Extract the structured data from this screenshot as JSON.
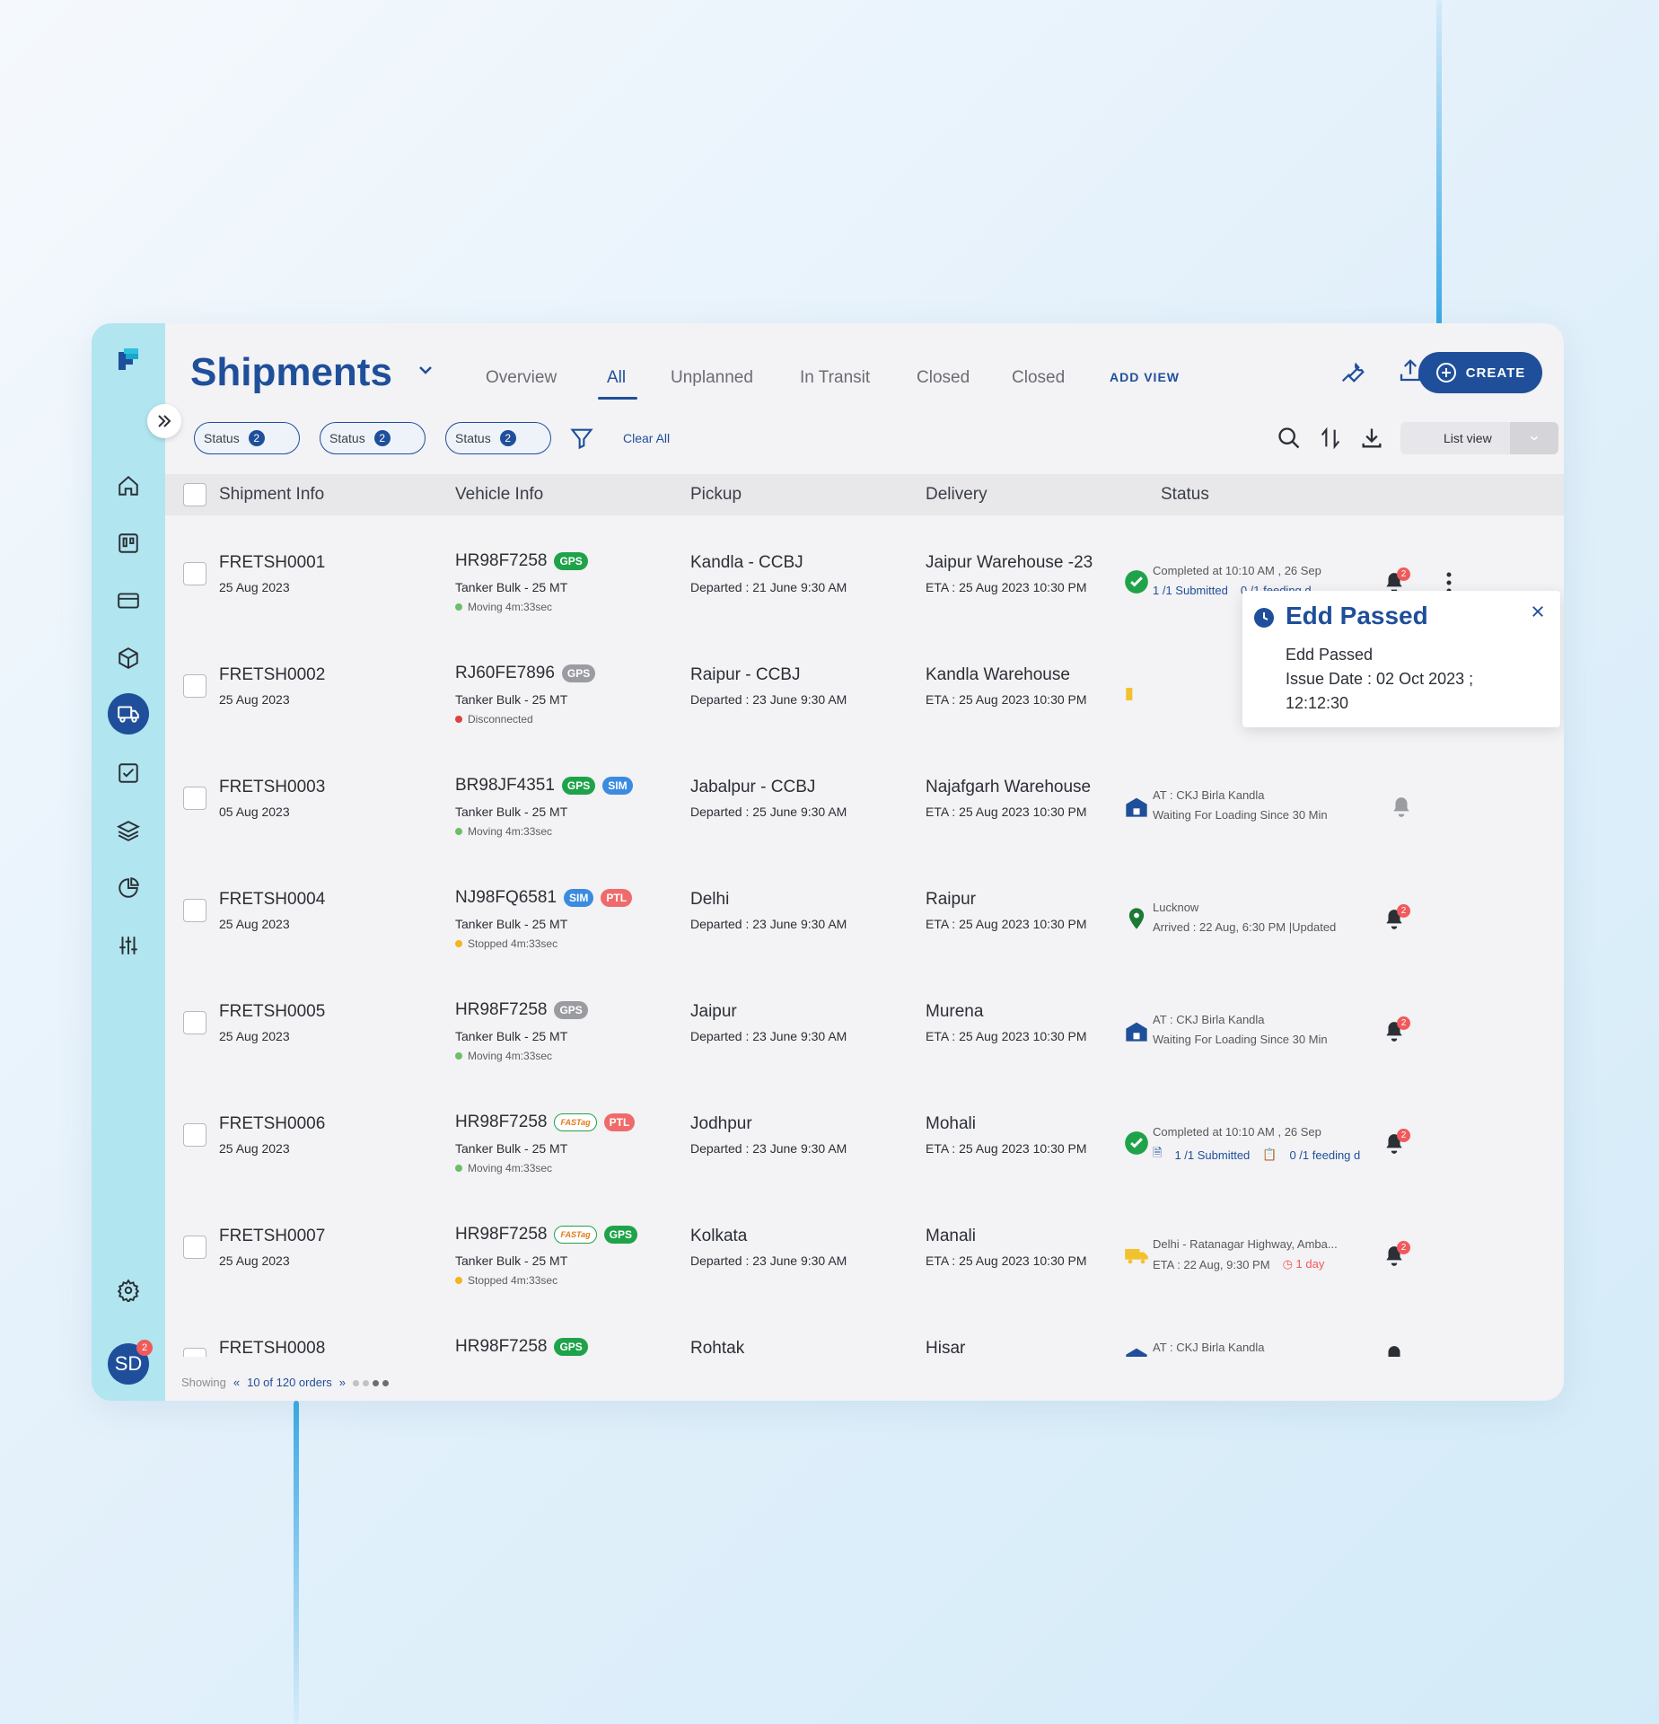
{
  "header": {
    "title": "Shipments",
    "tabs": [
      "Overview",
      "All",
      "Unplanned",
      "In Transit",
      "Closed",
      "Closed"
    ],
    "active_tab": "All",
    "add_view": "ADD VIEW",
    "create_label": "CREATE"
  },
  "filters": {
    "chips": [
      {
        "label": "Status",
        "count": "2"
      },
      {
        "label": "Status",
        "count": "2"
      },
      {
        "label": "Status",
        "count": "2"
      }
    ],
    "clear_all": "Clear All",
    "view_select": "List view"
  },
  "table": {
    "columns": [
      "Shipment Info",
      "Vehicle Info",
      "Pickup",
      "Delivery",
      "Status"
    ],
    "rows": [
      {
        "id": "FRETSH0001",
        "date": "25 Aug 2023",
        "vehicle": "HR98F7258",
        "vtype": "Tanker Bulk - 25 MT",
        "vstate": "Moving 4m:33sec",
        "pickup": "Kandla - CCBJ",
        "departed": "Departed : 21 June 9:30 AM",
        "delivery": "Jaipur Warehouse -23",
        "eta": "ETA : 25 Aug 2023 10:30 PM",
        "status_l1": "Completed at 10:10 AM , 26 Sep",
        "status_l2a": "1 /1 Submitted",
        "status_l2b": "0 /1 feeding d",
        "bell_count": "2"
      },
      {
        "id": "FRETSH0002",
        "date": "25 Aug 2023",
        "vehicle": "RJ60FE7896",
        "vtype": "Tanker Bulk - 25 MT",
        "vstate": "Disconnected",
        "pickup": "Raipur - CCBJ",
        "departed": "Departed : 23 June 9:30 AM",
        "delivery": "Kandla Warehouse",
        "eta": "ETA : 25 Aug 2023 10:30 PM"
      },
      {
        "id": "FRETSH0003",
        "date": "05 Aug 2023",
        "vehicle": "BR98JF4351",
        "vtype": "Tanker Bulk - 25 MT",
        "vstate": "Moving 4m:33sec",
        "pickup": "Jabalpur - CCBJ",
        "departed": "Departed : 25 June 9:30 AM",
        "delivery": "Najafgarh Warehouse",
        "eta": "ETA : 25 Aug 2023 10:30 PM",
        "status_l1": "AT : CKJ Birla Kandla",
        "status_l2": "Waiting For Loading Since 30 Min"
      },
      {
        "id": "FRETSH0004",
        "date": "25 Aug 2023",
        "vehicle": "NJ98FQ6581",
        "vtype": "Tanker Bulk - 25 MT",
        "vstate": "Stopped 4m:33sec",
        "pickup": "Delhi",
        "departed": "Departed : 23 June 9:30 AM",
        "delivery": "Raipur",
        "eta": "ETA : 25 Aug 2023 10:30 PM",
        "status_l1": "Lucknow",
        "status_l2": "Arrived : 22 Aug, 6:30 PM |Updated",
        "bell_count": "2"
      },
      {
        "id": "FRETSH0005",
        "date": "25 Aug 2023",
        "vehicle": "HR98F7258",
        "vtype": "Tanker Bulk - 25 MT",
        "vstate": "Moving 4m:33sec",
        "pickup": "Jaipur",
        "departed": "Departed : 23 June 9:30 AM",
        "delivery": "Murena",
        "eta": "ETA : 25 Aug 2023 10:30 PM",
        "status_l1": "AT : CKJ Birla Kandla",
        "status_l2": "Waiting For Loading Since 30 Min",
        "bell_count": "2"
      },
      {
        "id": "FRETSH0006",
        "date": "25 Aug 2023",
        "vehicle": "HR98F7258",
        "vtype": "Tanker Bulk - 25 MT",
        "vstate": "Moving 4m:33sec",
        "pickup": "Jodhpur",
        "departed": "Departed : 23 June 9:30 AM",
        "delivery": "Mohali",
        "eta": "ETA : 25 Aug 2023 10:30 PM",
        "status_l1": "Completed at 10:10 AM , 26 Sep",
        "status_l2a": "1 /1 Submitted",
        "status_l2b": "0 /1 feeding d",
        "bell_count": "2"
      },
      {
        "id": "FRETSH0007",
        "date": "25 Aug 2023",
        "vehicle": "HR98F7258",
        "vtype": "Tanker Bulk - 25 MT",
        "vstate": "Stopped 4m:33sec",
        "pickup": "Kolkata",
        "departed": "Departed : 23 June 9:30 AM",
        "delivery": "Manali",
        "eta": "ETA : 25 Aug 2023 10:30 PM",
        "status_l1": "Delhi - Ratanagar Highway, Amba...",
        "status_l2": "ETA : 22 Aug,  9:30 PM",
        "status_late": "1 day",
        "bell_count": "2"
      },
      {
        "id": "FRETSH0008",
        "vehicle": "HR98F7258",
        "pickup": "Rohtak",
        "delivery": "Hisar",
        "status_l1": "AT : CKJ Birla Kandla",
        "bell_count": "2"
      }
    ],
    "tags": {
      "gps": "GPS",
      "sim": "SIM",
      "ptl": "PTL",
      "fastag": "FASTag"
    }
  },
  "popover": {
    "title": "Edd Passed",
    "line1": "Edd Passed",
    "line2": "Issue Date : 02 Oct 2023 ; 12:12:30"
  },
  "footer": {
    "showing": "Showing",
    "pagination": "10 of 120 orders"
  },
  "user": {
    "initials": "SD",
    "badge": "2"
  },
  "colors": {
    "brand": "#1f4f9a",
    "sidebar": "#b1e5ef",
    "gps_green": "#1fa34a",
    "sim_blue": "#3b8be0",
    "ptl_red": "#ef6b6b",
    "gps_gray": "#9a9ca2"
  }
}
